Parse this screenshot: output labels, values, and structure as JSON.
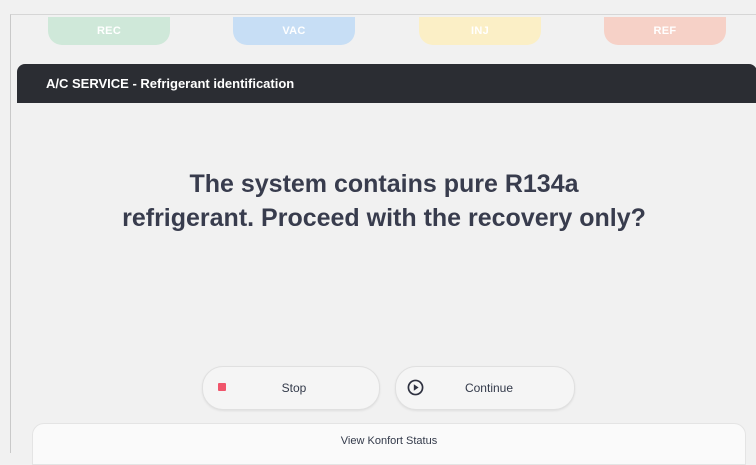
{
  "steps": {
    "rec": {
      "label": "REC",
      "color": "#cfe8d9"
    },
    "vac": {
      "label": "VAC",
      "color": "#c7def5"
    },
    "inj": {
      "label": "INJ",
      "color": "#fbefc6"
    },
    "ref": {
      "label": "REF",
      "color": "#f6d1c7"
    }
  },
  "header": {
    "title": "A/C SERVICE - Refrigerant identification",
    "background": "#2b2d33"
  },
  "dialog": {
    "question_line1": "The system contains pure R134a",
    "question_line2": "refrigerant. Proceed with the recovery only?"
  },
  "actions": {
    "stop": {
      "label": "Stop",
      "icon": "stop-square-icon",
      "icon_color": "#f0556b"
    },
    "continue": {
      "label": "Continue",
      "icon": "play-circle-icon"
    }
  },
  "footer": {
    "label": "View Konfort Status"
  }
}
